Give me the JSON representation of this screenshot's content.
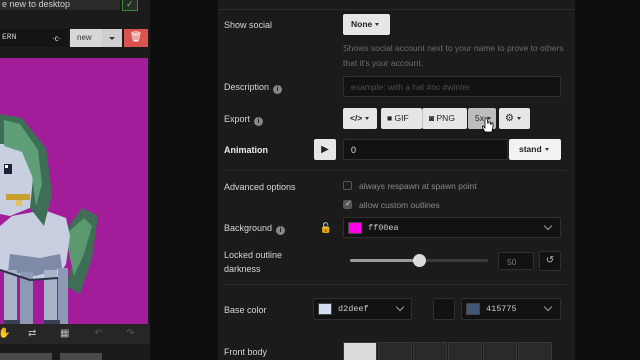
{
  "left_panel": {
    "tip_text": "e new to desktop",
    "pattern_name": "ERN",
    "pattern_dropdown_glyph": "·c·",
    "new_label": "new",
    "delete_glyph": "🗑",
    "canvas_background": "#a31d9a",
    "toolbar_icons": [
      "hand-icon",
      "swap-icon",
      "grid-icon",
      "undo-icon",
      "redo-icon"
    ]
  },
  "settings": {
    "show_social": {
      "label": "Show social",
      "value": "None",
      "help": "Shows social account next to your name to prove to others that it's your account."
    },
    "description": {
      "label": "Description",
      "placeholder": "example: with a hat #oc #winter"
    },
    "export": {
      "label": "Export",
      "code_label": "</>",
      "gif_label": "GIF",
      "png_label": "PNG",
      "scale_label": "5x"
    },
    "animation": {
      "label": "Animation",
      "frame": "0",
      "state": "stand"
    },
    "advanced": {
      "label": "Advanced options",
      "option1": "always respawn at spawn point",
      "option1_checked": false,
      "option2": "allow custom outlines",
      "option2_checked": true
    },
    "background": {
      "label": "Background",
      "color": "#ff00ea",
      "value": "ff00ea"
    },
    "outline": {
      "label1": "Locked outline",
      "label2": "darkness",
      "value": "50",
      "level_percent": 50
    },
    "base_color": {
      "label": "Base color",
      "value1": "d2deef",
      "color1": "#d2deef",
      "value2": "415775",
      "color2": "#415775"
    },
    "front_body": {
      "label": "Front body"
    }
  }
}
